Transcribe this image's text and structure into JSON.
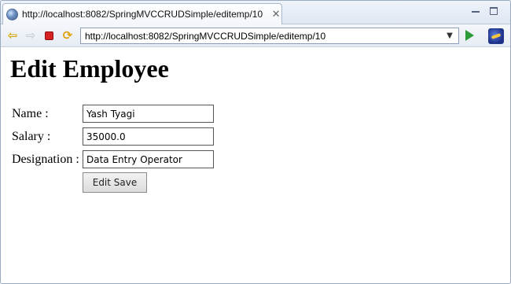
{
  "tab": {
    "title": "http://localhost:8082/SpringMVCCRUDSimple/editemp/10",
    "close_icon": "✕"
  },
  "toolbar": {
    "url": "http://localhost:8082/SpringMVCCRUDSimple/editemp/10"
  },
  "page": {
    "heading": "Edit Employee",
    "form": {
      "name_label": "Name :",
      "name_value": "Yash Tyagi",
      "salary_label": "Salary :",
      "salary_value": "35000.0",
      "designation_label": "Designation :",
      "designation_value": "Data Entry Operator",
      "submit_label": "Edit Save"
    }
  },
  "icons": [
    "globe-icon",
    "close-icon",
    "minimize-icon",
    "maximize-icon",
    "back-icon",
    "forward-icon",
    "stop-icon",
    "refresh-icon",
    "dropdown-icon",
    "go-icon",
    "eclipse-icon"
  ]
}
